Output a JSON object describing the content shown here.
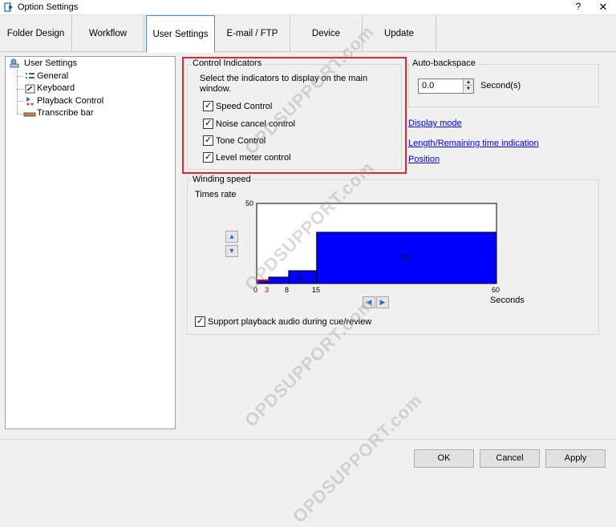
{
  "window": {
    "title": "Option Settings",
    "help": "?",
    "close": "✕"
  },
  "tabs": [
    {
      "label": "Folder Design"
    },
    {
      "label": "Workflow"
    },
    {
      "label": "User Settings"
    },
    {
      "label": "E-mail / FTP"
    },
    {
      "label": "Device"
    },
    {
      "label": "Update"
    }
  ],
  "tree": {
    "root": "User Settings",
    "items": [
      "General",
      "Keyboard",
      "Playback Control",
      "Transcribe bar"
    ]
  },
  "control_indicators": {
    "title": "Control Indicators",
    "description": "Select the indicators to display on the main window.",
    "options": [
      {
        "label": "Speed Control",
        "checked": true
      },
      {
        "label": "Noise cancel control",
        "checked": true
      },
      {
        "label": "Tone Control",
        "checked": true
      },
      {
        "label": "Level meter control",
        "checked": true
      }
    ]
  },
  "auto_backspace": {
    "title": "Auto-backspace",
    "value": "0.0",
    "unit": "Second(s)"
  },
  "links": {
    "display_mode": "Display mode",
    "length_remaining": "Length/Remaining time indication",
    "position": "Position"
  },
  "winding_speed": {
    "title": "Winding speed",
    "ylabel": "Times rate",
    "xlabel": "Seconds",
    "y_max_label": "50",
    "x_ticks": [
      "0",
      "3",
      "8",
      "15",
      "60"
    ],
    "step_labels": [
      "8",
      "32"
    ],
    "support_label": "Support playback audio during cue/review",
    "support_checked": true
  },
  "chart_data": {
    "type": "bar",
    "title": "",
    "xlabel": "Seconds",
    "ylabel": "Times rate",
    "xlim": [
      0,
      60
    ],
    "ylim": [
      0,
      50
    ],
    "steps": [
      {
        "from": 0,
        "to": 3,
        "value": 2
      },
      {
        "from": 3,
        "to": 8,
        "value": 4
      },
      {
        "from": 8,
        "to": 15,
        "value": 8
      },
      {
        "from": 15,
        "to": 60,
        "value": 32
      }
    ]
  },
  "buttons": {
    "ok": "OK",
    "cancel": "Cancel",
    "apply": "Apply"
  },
  "watermark": "OPDSUPPORT.com",
  "colors": {
    "highlight": "#e8242b",
    "bar_fill": "#0000ff",
    "link": "#0000ee"
  }
}
